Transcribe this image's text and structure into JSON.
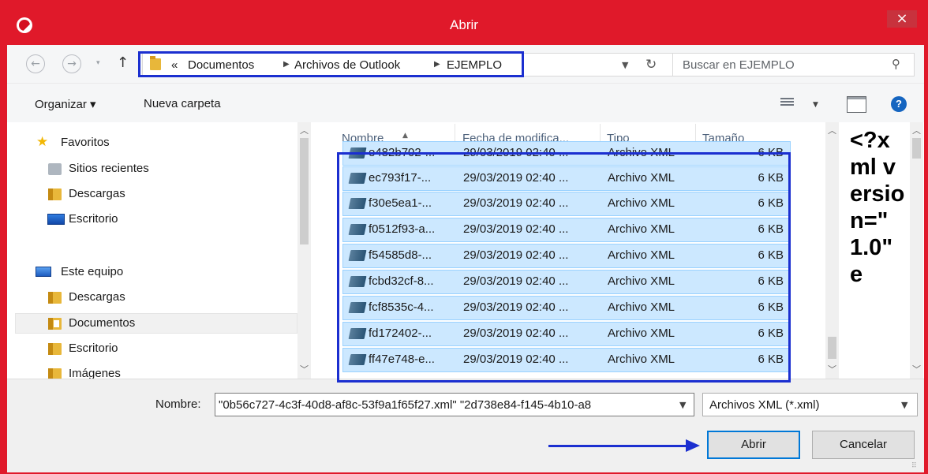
{
  "window": {
    "title": "Abrir",
    "close_label": "×",
    "accent": "#e0192a",
    "annotation": "#1b2fd0"
  },
  "nav": {
    "back_label": "←",
    "forward_label": "→",
    "up_label": "↑",
    "breadcrumb_prefix": "«",
    "breadcrumb": [
      "Documentos",
      "Archivos de Outlook",
      "EJEMPLO"
    ],
    "search_placeholder": "Buscar en EJEMPLO"
  },
  "toolbar": {
    "organize_label": "Organizar ▾",
    "new_folder_label": "Nueva carpeta",
    "help_label": "?"
  },
  "navpane": {
    "items": [
      {
        "label": "Favoritos",
        "icon": "star-icon"
      },
      {
        "label": "Sitios recientes",
        "icon": "recent-places-icon"
      },
      {
        "label": "Descargas",
        "icon": "folder-icon"
      },
      {
        "label": "Escritorio",
        "icon": "desktop-icon"
      },
      {
        "label": "Este equipo",
        "icon": "computer-icon"
      },
      {
        "label": "Descargas",
        "icon": "folder-icon"
      },
      {
        "label": "Documentos",
        "icon": "documents-folder-icon",
        "selected": true
      },
      {
        "label": "Escritorio",
        "icon": "folder-icon"
      },
      {
        "label": "Imágenes",
        "icon": "folder-icon"
      }
    ]
  },
  "filelist": {
    "columns": [
      "Nombre",
      "Fecha de modifica...",
      "Tipo",
      "Tamaño"
    ],
    "rows": [
      {
        "name": "e482b702-...",
        "date": "29/03/2019 02:40 ...",
        "type": "Archivo XML",
        "size": "6 KB"
      },
      {
        "name": "ec793f17-...",
        "date": "29/03/2019 02:40 ...",
        "type": "Archivo XML",
        "size": "6 KB"
      },
      {
        "name": "f30e5ea1-...",
        "date": "29/03/2019 02:40 ...",
        "type": "Archivo XML",
        "size": "6 KB"
      },
      {
        "name": "f0512f93-a...",
        "date": "29/03/2019 02:40 ...",
        "type": "Archivo XML",
        "size": "6 KB"
      },
      {
        "name": "f54585d8-...",
        "date": "29/03/2019 02:40 ...",
        "type": "Archivo XML",
        "size": "6 KB"
      },
      {
        "name": "fcbd32cf-8...",
        "date": "29/03/2019 02:40 ...",
        "type": "Archivo XML",
        "size": "6 KB"
      },
      {
        "name": "fcf8535c-4...",
        "date": "29/03/2019 02:40 ...",
        "type": "Archivo XML",
        "size": "6 KB"
      },
      {
        "name": "fd172402-...",
        "date": "29/03/2019 02:40 ...",
        "type": "Archivo XML",
        "size": "6 KB"
      },
      {
        "name": "ff47e748-e...",
        "date": "29/03/2019 02:40 ...",
        "type": "Archivo XML",
        "size": "6 KB"
      }
    ]
  },
  "preview": {
    "text": "<?xml version=\" 1.0\" e"
  },
  "bottom": {
    "name_label": "Nombre:",
    "name_value": "\"0b56c727-4c3f-40d8-af8c-53f9a1f65f27.xml\" \"2d738e84-f145-4b10-a8",
    "filetype": "Archivos XML (*.xml)",
    "open_label": "Abrir",
    "cancel_label": "Cancelar"
  }
}
